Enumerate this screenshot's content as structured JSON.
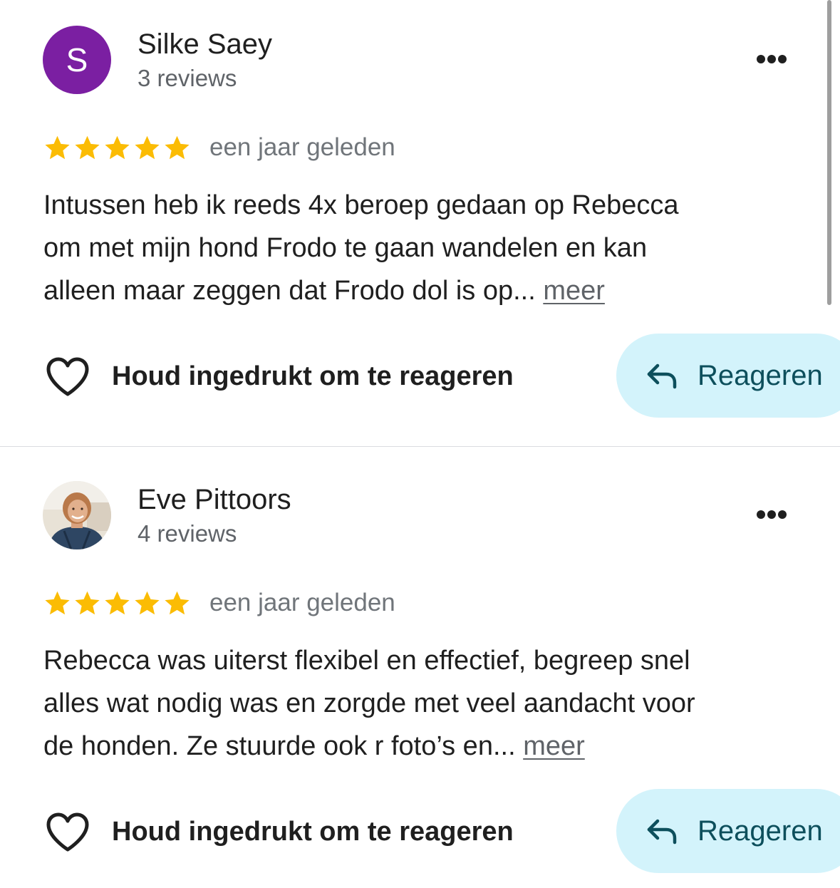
{
  "reviews": [
    {
      "avatar": {
        "type": "letter",
        "letter": "S",
        "color": "#7b1fa2"
      },
      "name": "Silke Saey",
      "review_count": "3 reviews",
      "rating": 5,
      "date": "een jaar geleden",
      "text_lines": [
        "Intussen heb ik reeds 4x beroep gedaan op Rebecca",
        "om met mijn hond Frodo te gaan wandelen en kan",
        "alleen maar zeggen dat Frodo dol is op... "
      ],
      "more_label": "meer",
      "like_label": "Houd ingedrukt om te reageren",
      "reply_label": "Reageren"
    },
    {
      "avatar": {
        "type": "photo",
        "icon": "profile-photo"
      },
      "name": "Eve Pittoors",
      "review_count": "4 reviews",
      "rating": 5,
      "date": "een jaar geleden",
      "text_lines": [
        "Rebecca was uiterst flexibel en effectief, begreep snel",
        "alles wat nodig was en zorgde met veel aandacht voor",
        "de honden. Ze stuurde ook r foto’s  en... "
      ],
      "more_label": "meer",
      "like_label": "Houd ingedrukt om te reageren",
      "reply_label": "Reageren"
    }
  ],
  "icons": {
    "more": "more-horizontal-icon",
    "star": "star-icon",
    "like": "heart-outline-icon",
    "reply": "reply-arrow-icon"
  },
  "colors": {
    "star": "#fbbc04",
    "reply_background": "#d3f3fb",
    "reply_text": "#0d4f5c",
    "secondary_text": "#5f6368"
  }
}
